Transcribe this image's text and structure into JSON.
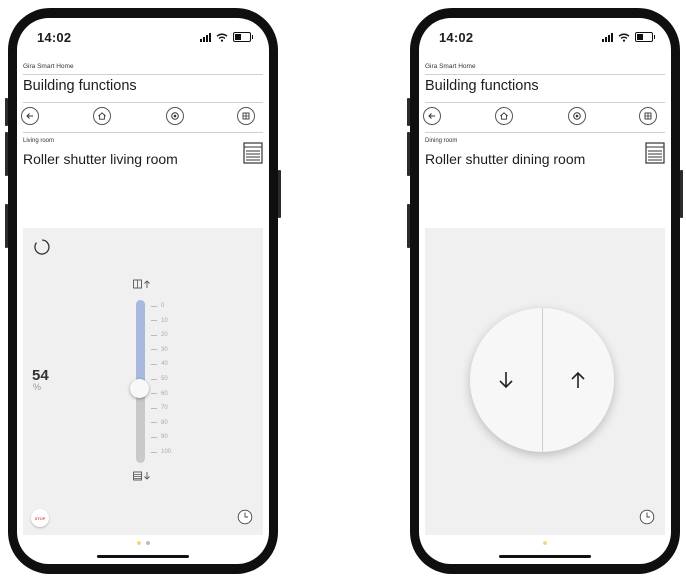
{
  "screens": [
    {
      "time": "14:02",
      "app_name": "Gira Smart Home",
      "page_title": "Building functions",
      "room": "Living room",
      "device": "Roller shutter living room",
      "position_value": "54",
      "position_unit": "%",
      "position_percent": 54,
      "scale": [
        "0",
        "10",
        "20",
        "30",
        "40",
        "50",
        "60",
        "70",
        "80",
        "90",
        "100"
      ],
      "stop_label": "STOP",
      "page_dots": 2,
      "active_dot": 0
    },
    {
      "time": "14:02",
      "app_name": "Gira Smart Home",
      "page_title": "Building functions",
      "room": "Dining room",
      "device": "Roller shutter dining room",
      "page_dots": 1,
      "active_dot": 0
    }
  ],
  "icons": {
    "nav": [
      "back-arrow-icon",
      "home-icon",
      "settings-icon",
      "grid-icon"
    ],
    "device": "roller-shutter-icon",
    "down_button": "arrow-down-icon",
    "up_button": "arrow-up-icon",
    "timer": "clock-icon"
  },
  "colors": {
    "slider_fill": "#a9b8de",
    "slider_track": "#c9c9c9",
    "panel_bg": "#f0f0f0",
    "stop_text": "#e05555",
    "active_dot": "#f2d97d"
  }
}
